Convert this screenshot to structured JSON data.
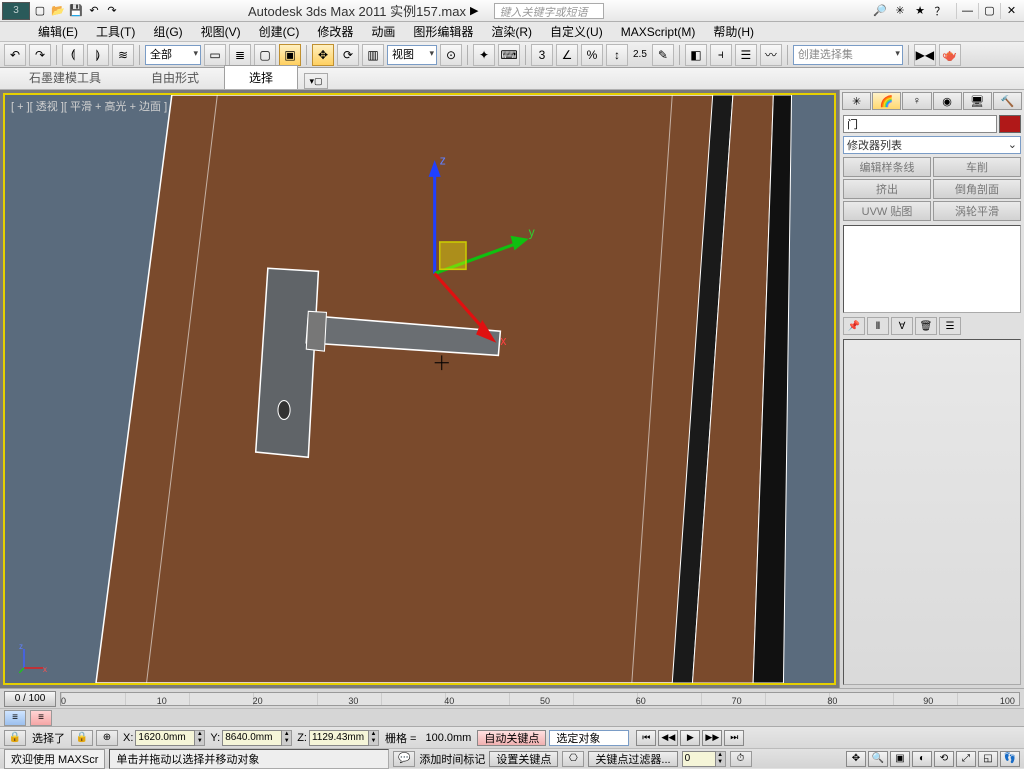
{
  "title": "Autodesk 3ds Max 2011   实例157.max",
  "search_placeholder": "键入关键字或短语",
  "menus": [
    "编辑(E)",
    "工具(T)",
    "组(G)",
    "视图(V)",
    "创建(C)",
    "修改器",
    "动画",
    "图形编辑器",
    "渲染(R)",
    "自定义(U)",
    "MAXScript(M)",
    "帮助(H)"
  ],
  "toolbar": {
    "filter": "全部",
    "viewmode": "视图",
    "snap_angle": "2.5",
    "create_set_placeholder": "创建选择集"
  },
  "ribbon": {
    "tabs": [
      "石墨建模工具",
      "自由形式",
      "选择"
    ],
    "active": 2
  },
  "viewport": {
    "label": "[ + ][ 透视 ][ 平滑 + 高光 + 边面 ]"
  },
  "cmd": {
    "object_name": "门",
    "modifier_list": "修改器列表",
    "buttons": [
      "编辑样条线",
      "车削",
      "挤出",
      "倒角剖面",
      "UVW 贴图",
      "涡轮平滑"
    ]
  },
  "time": {
    "slider": "0 / 100",
    "ticks": [
      0,
      10,
      20,
      30,
      40,
      50,
      60,
      70,
      80,
      90,
      100
    ]
  },
  "status": {
    "selected": "选择了",
    "x": "1620.0mm",
    "y": "8640.0mm",
    "z": "1129.43mm",
    "grid_label": "栅格 =",
    "grid_val": "100.0mm",
    "auto_key": "自动关键点",
    "sel_obj": "选定对象",
    "set_key": "设置关键点",
    "key_filter": "关键点过滤器...",
    "add_time_tag": "添加时间标记",
    "frame": "0"
  },
  "status2": {
    "welcome": "欢迎使用 MAXScr",
    "prompt": "单击并拖动以选择并移动对象"
  }
}
